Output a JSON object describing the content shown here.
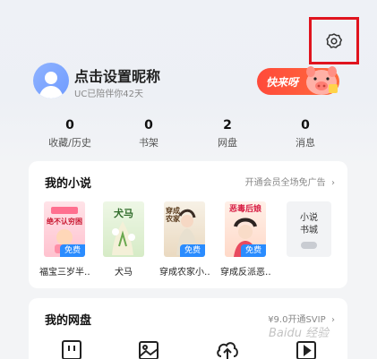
{
  "header": {
    "settings_icon": "gear-icon"
  },
  "profile": {
    "avatar_icon": "default-avatar-icon",
    "nickname": "点击设置昵称",
    "accompany_text": "UC已陪伴你42天",
    "promo": {
      "label": "快来呀",
      "icon": "pig-mascot-icon",
      "color": "#ff4a3a"
    }
  },
  "stats": [
    {
      "count": "0",
      "label": "收藏/历史"
    },
    {
      "count": "0",
      "label": "书架"
    },
    {
      "count": "2",
      "label": "网盘"
    },
    {
      "count": "0",
      "label": "消息"
    }
  ],
  "novels": {
    "title": "我的小说",
    "link": "开通会员全场免广告",
    "link_icon": "chevron-right-icon",
    "books": [
      {
        "title": "福宝三岁半…",
        "cover_text": "绝不认穷困",
        "tag": "免费"
      },
      {
        "title": "犬马",
        "cover_text": "犬马",
        "tag": ""
      },
      {
        "title": "穿成农家小…",
        "cover_text": "穿成农家",
        "tag": "免费"
      },
      {
        "title": "穿成反派恶…",
        "cover_text": "恶毒后娘",
        "tag": "免费"
      }
    ],
    "bookstore_label": "小说\n书城"
  },
  "netdisk": {
    "title": "我的网盘",
    "link": "¥9.0开通SVIP",
    "link_icon": "chevron-right-icon",
    "icons": [
      "folder-icon",
      "image-icon",
      "cloud-upload-icon",
      "video-icon"
    ]
  },
  "watermark": "Baidu 经验",
  "colors": {
    "accent_red": "#e0141e",
    "free_tag_blue": "#2a8cff",
    "avatar_blue": "#7aa3ff"
  }
}
